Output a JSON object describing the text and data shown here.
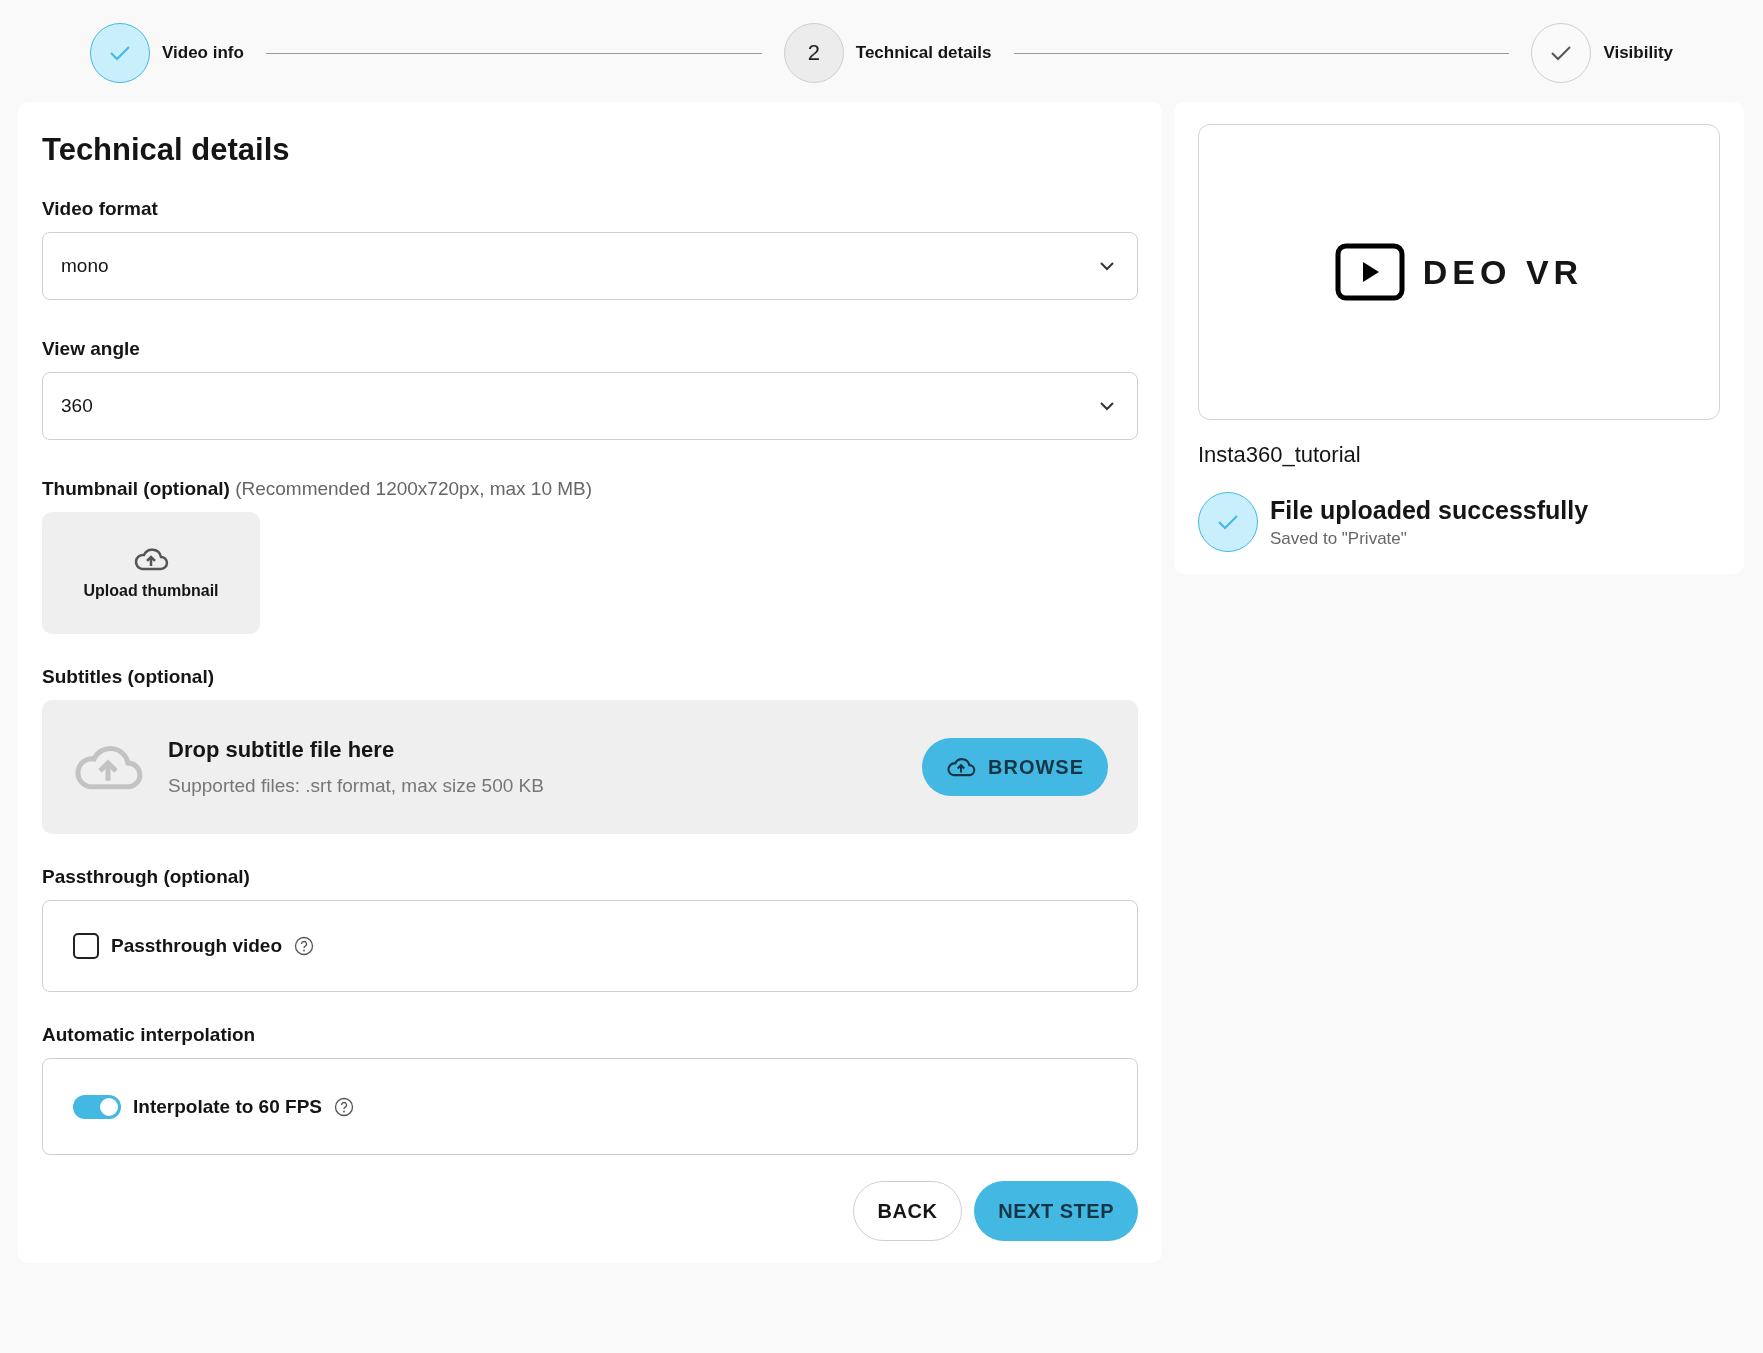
{
  "stepper": [
    {
      "label": "Video info",
      "kind": "complete"
    },
    {
      "label": "Technical details",
      "kind": "current",
      "number": "2"
    },
    {
      "label": "Visibility",
      "kind": "pending"
    }
  ],
  "form": {
    "title": "Technical details",
    "video_format": {
      "label": "Video format",
      "value": "mono"
    },
    "view_angle": {
      "label": "View angle",
      "value": "360"
    },
    "thumbnail": {
      "label": "Thumbnail (optional)",
      "hint": "(Recommended 1200x720px, max 10 MB)",
      "button": "Upload thumbnail"
    },
    "subtitles": {
      "label": "Subtitles (optional)",
      "drop_title": "Drop subtitle file here",
      "drop_hint": "Supported files: .srt format, max size 500 KB",
      "button": "BROWSE"
    },
    "passthrough": {
      "label": "Passthrough (optional)",
      "option": "Passthrough video",
      "checked": false
    },
    "interpolation": {
      "label": "Automatic interpolation",
      "option": "Interpolate to 60 FPS",
      "on": true
    },
    "buttons": {
      "back": "BACK",
      "next": "NEXT STEP"
    }
  },
  "preview": {
    "logo_text": "DEO VR",
    "file_name": "Insta360_tutorial",
    "status_title": "File uploaded successfully",
    "status_detail": "Saved to \"Private\""
  }
}
